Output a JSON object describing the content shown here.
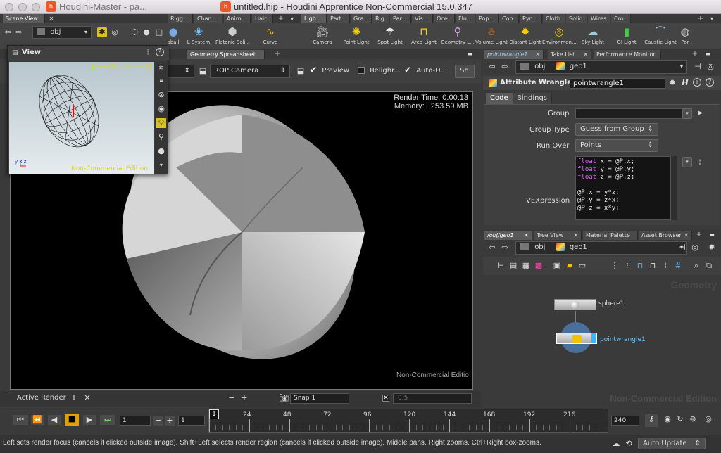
{
  "windows": {
    "left_title": "Houdini-Master - pa...",
    "main_title": "untitled.hip - Houdini Apprentice Non-Commercial 15.0.347"
  },
  "left_shelf": {
    "tabs": [
      "Scene View",
      "Rigg...",
      "Char...",
      "Anim...",
      "Hair"
    ],
    "tools": [
      {
        "label": "aball",
        "icon": "ball-icon"
      },
      {
        "label": "L-System",
        "icon": "lsystem-icon"
      },
      {
        "label": "Platonic Soli...",
        "icon": "platonic-icon"
      },
      {
        "label": "Curve",
        "icon": "curve-icon"
      }
    ],
    "path": "obj"
  },
  "right_shelf": {
    "tabs": [
      "Ligh...",
      "Part...",
      "Gra...",
      "Rig...",
      "Par...",
      "Vis...",
      "Oce...",
      "Flu...",
      "Pop...",
      "Con...",
      "Pyr...",
      "Cloth",
      "Solid",
      "Wires",
      "Cro..."
    ],
    "tools": [
      {
        "label": "Camera",
        "icon": "camera-icon"
      },
      {
        "label": "Point Light",
        "icon": "point-light-icon"
      },
      {
        "label": "Spot Light",
        "icon": "spot-light-icon"
      },
      {
        "label": "Area Light",
        "icon": "area-light-icon"
      },
      {
        "label": "Geometry L...",
        "icon": "geometry-light-icon"
      },
      {
        "label": "Volume Light",
        "icon": "volume-light-icon"
      },
      {
        "label": "Distant Light",
        "icon": "distant-light-icon"
      },
      {
        "label": "Environmen...",
        "icon": "environment-light-icon"
      },
      {
        "label": "Sky Light",
        "icon": "sky-light-icon"
      },
      {
        "label": "GI Light",
        "icon": "gi-light-icon"
      },
      {
        "label": "Caustic Light",
        "icon": "caustic-light-icon"
      },
      {
        "label": "Por",
        "icon": "portal-light-icon"
      }
    ]
  },
  "floating_view": {
    "title": "View",
    "persp_label": "persp1-",
    "cam_label": "no cam-",
    "watermark": "Non-Commercial Edition",
    "axes": "y x z"
  },
  "render_view": {
    "tabs": [
      "Geometry Spreadsheet"
    ],
    "dropdown_left": "r",
    "camera_dropdown": "ROP Camera",
    "preview_label": "Preview",
    "preview_checked": true,
    "relight_label": "Relighr...",
    "relight_checked": false,
    "auto_update_label": "Auto-U...",
    "auto_update_checked": true,
    "sh_button": "Sh",
    "render_time_label": "Render Time:",
    "render_time": "0:00:13",
    "memory_label": "Memory:",
    "memory": "253.59 MB",
    "watermark": "Non-Commercial Editio",
    "active_render": "Active Render",
    "snap_label": "Snap 1",
    "snap_value": "0.5"
  },
  "parameter_pane": {
    "tabs": [
      "pointwrangle1",
      "Take List",
      "Performance Monitor"
    ],
    "path_obj": "obj",
    "path_geo": "geo1",
    "node_type": "Attribute Wrangle",
    "node_name": "pointwrangle1",
    "sub_tabs": [
      "Code",
      "Bindings"
    ],
    "group_label": "Group",
    "group_value": "",
    "group_type_label": "Group Type",
    "group_type_value": "Guess from Group",
    "run_over_label": "Run Over",
    "run_over_value": "Points",
    "vex_label": "VEXpression",
    "vex_lines": [
      {
        "kw": "float",
        "rest": " x = @P.x;"
      },
      {
        "kw": "float",
        "rest": " y = @P.y;"
      },
      {
        "kw": "float",
        "rest": " z = @P.z;"
      },
      {
        "kw": "",
        "rest": ""
      },
      {
        "kw": "",
        "rest": "@P.x = y*z;"
      },
      {
        "kw": "",
        "rest": "@P.y = z*x;"
      },
      {
        "kw": "",
        "rest": "@P.z = x*y;"
      }
    ]
  },
  "network_pane": {
    "tabs": [
      "/obj/geo1",
      "Tree View",
      "Material Palette",
      "Asset Browser"
    ],
    "path_obj": "obj",
    "path_geo": "geo1",
    "context_label": "Geometry",
    "nodes": [
      {
        "name": "sphere1"
      },
      {
        "name": "pointwrangle1"
      }
    ],
    "watermark": "Non-Commercial Edition"
  },
  "timeline": {
    "current_frame": "1",
    "step": "1",
    "start_label": "1",
    "ticks": [
      "24",
      "48",
      "72",
      "96",
      "120",
      "144",
      "168",
      "192",
      "216"
    ],
    "end_frame": "240",
    "auto_update": "Auto Update"
  },
  "status_bar": {
    "message": "Left sets render focus (cancels if clicked outside image). Shift+Left selects render region (cancels if clicked outside image). Middle pans. Right zooms. Ctrl+Right box-zooms."
  }
}
